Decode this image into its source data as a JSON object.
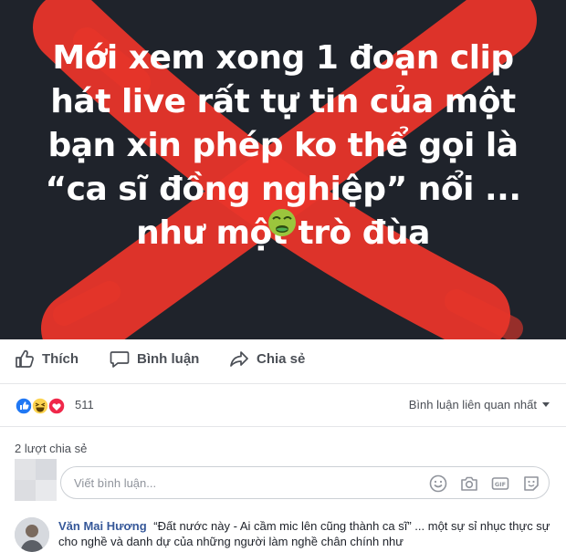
{
  "post": {
    "image_text": "Mới xem xong 1 đoạn clip hát live rất tự tin của một bạn xin phép ko thể gọi là “ca sĩ đồng nghiệp” nổi ... như một trò đùa",
    "emoji_icon": "nauseated-face-emoji"
  },
  "actions": {
    "like_label": "Thích",
    "comment_label": "Bình luận",
    "share_label": "Chia sẻ"
  },
  "reactions": {
    "icons": [
      "like-reaction-icon",
      "haha-reaction-icon",
      "love-reaction-icon"
    ],
    "count": "511",
    "sort_label": "Bình luận liên quan nhất"
  },
  "shares": {
    "label": "2 lượt chia sẻ"
  },
  "compose": {
    "placeholder": "Viết bình luận..."
  },
  "comment": {
    "author": "Văn Mai Hương",
    "text": "“Đất nước này - Ai cầm mic lên cũng thành ca sĩ” ... một sự sỉ nhục thực sự cho nghề và danh dự của những người làm nghề chân chính như"
  },
  "colors": {
    "image_bg": "#1f232b",
    "cross_red": "#e8352a",
    "link_blue": "#365899",
    "text_grey": "#4b4f56"
  }
}
